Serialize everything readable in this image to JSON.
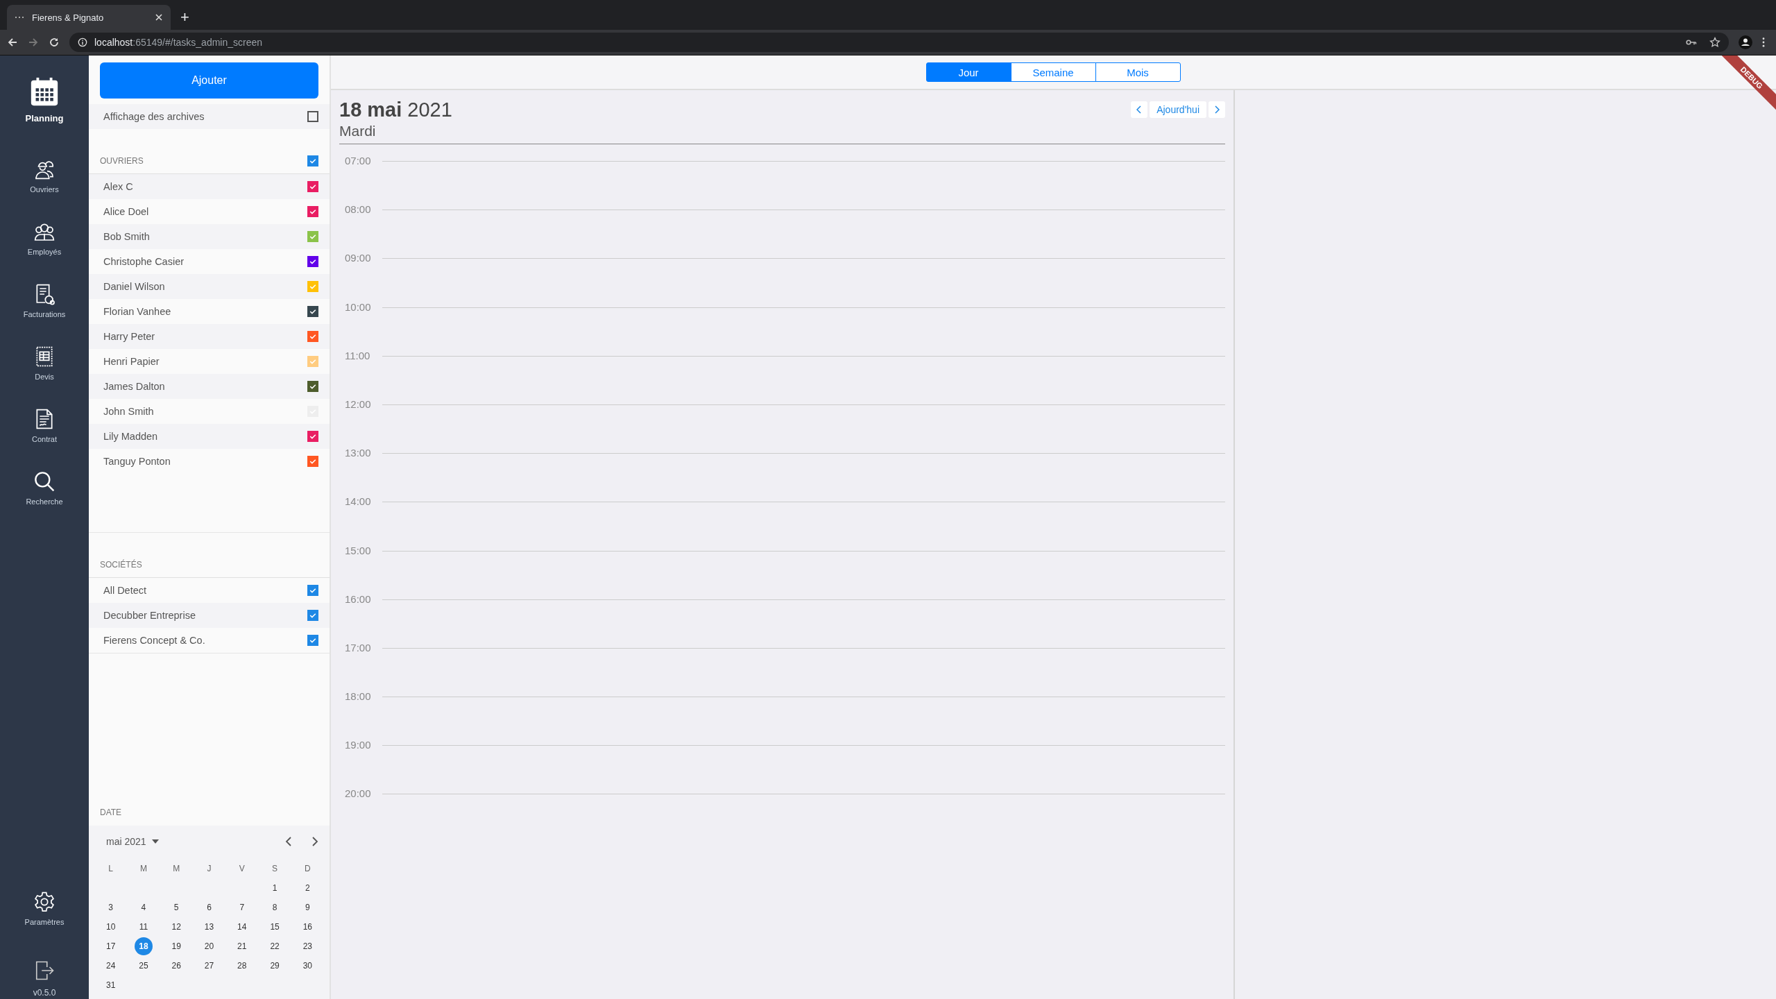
{
  "browser": {
    "tab_title": "Fierens & Pignato",
    "new_tab": "+",
    "url": {
      "host": "localhost",
      "path": ":65149/#/tasks_admin_screen"
    }
  },
  "nav": {
    "items": [
      {
        "label": "Planning",
        "selected": true
      },
      {
        "label": "Ouvriers",
        "selected": false
      },
      {
        "label": "Employés",
        "selected": false
      },
      {
        "label": "Facturations",
        "selected": false
      },
      {
        "label": "Devis",
        "selected": false
      },
      {
        "label": "Contrat",
        "selected": false
      },
      {
        "label": "Recherche",
        "selected": false
      }
    ],
    "settings": {
      "label": "Paramètres"
    },
    "version": "v0.5.0"
  },
  "panel": {
    "add_button": "Ajouter",
    "archives": {
      "label": "Affichage des archives",
      "checked": false
    },
    "workers": {
      "title": "OUVRIERS",
      "checked": true,
      "items": [
        {
          "name": "Alex C",
          "checked": true,
          "color": "#e91e63"
        },
        {
          "name": "Alice Doel",
          "checked": true,
          "color": "#e91e63"
        },
        {
          "name": "Bob Smith",
          "checked": true,
          "color": "#8bc34a"
        },
        {
          "name": "Christophe Casier",
          "checked": true,
          "color": "#6200ea"
        },
        {
          "name": "Daniel Wilson",
          "checked": true,
          "color": "#ffc107"
        },
        {
          "name": "Florian Vanhee",
          "checked": true,
          "color": "#37474f"
        },
        {
          "name": "Harry Peter",
          "checked": true,
          "color": "#ff5722"
        },
        {
          "name": "Henri Papier",
          "checked": true,
          "color": "#ffcc80"
        },
        {
          "name": "James Dalton",
          "checked": true,
          "color": "#4e5d2c"
        },
        {
          "name": "John Smith",
          "checked": true,
          "color": "#eeeeee"
        },
        {
          "name": "Lily Madden",
          "checked": true,
          "color": "#e91e63"
        },
        {
          "name": "Tanguy Ponton",
          "checked": true,
          "color": "#ff5722"
        }
      ]
    },
    "companies": {
      "title": "SOCIÉTÉS",
      "items": [
        {
          "name": "All Detect",
          "checked": true
        },
        {
          "name": "Decubber Entreprise",
          "checked": true
        },
        {
          "name": "Fierens Concept & Co.",
          "checked": true
        }
      ]
    },
    "date": {
      "title": "DATE",
      "month": "mai 2021",
      "weekdays": [
        "L",
        "M",
        "M",
        "J",
        "V",
        "S",
        "D"
      ],
      "weeks": [
        [
          {
            "day": "1",
            "selected": false
          },
          {
            "day": "2",
            "selected": false
          }
        ],
        [
          {
            "day": "3",
            "selected": false
          },
          {
            "day": "4",
            "selected": false
          },
          {
            "day": "5",
            "selected": false
          },
          {
            "day": "6",
            "selected": false
          },
          {
            "day": "7",
            "selected": false
          },
          {
            "day": "8",
            "selected": false
          },
          {
            "day": "9",
            "selected": false
          }
        ],
        [
          {
            "day": "10",
            "selected": false
          },
          {
            "day": "11",
            "selected": false
          },
          {
            "day": "12",
            "selected": false
          },
          {
            "day": "13",
            "selected": false
          },
          {
            "day": "14",
            "selected": false
          },
          {
            "day": "15",
            "selected": false
          },
          {
            "day": "16",
            "selected": false
          }
        ],
        [
          {
            "day": "17",
            "selected": false
          },
          {
            "day": "18",
            "selected": true
          },
          {
            "day": "19",
            "selected": false
          },
          {
            "day": "20",
            "selected": false
          },
          {
            "day": "21",
            "selected": false
          },
          {
            "day": "22",
            "selected": false
          },
          {
            "day": "23",
            "selected": false
          }
        ],
        [
          {
            "day": "24",
            "selected": false
          },
          {
            "day": "25",
            "selected": false
          },
          {
            "day": "26",
            "selected": false
          },
          {
            "day": "27",
            "selected": false
          },
          {
            "day": "28",
            "selected": false
          },
          {
            "day": "29",
            "selected": false
          },
          {
            "day": "30",
            "selected": false
          }
        ],
        [
          {
            "day": "31",
            "selected": false
          }
        ]
      ]
    }
  },
  "views": [
    {
      "label": "Jour",
      "selected": true
    },
    {
      "label": "Semaine",
      "selected": false
    },
    {
      "label": "Mois",
      "selected": false
    }
  ],
  "day": {
    "date": "18 mai",
    "year": "2021",
    "weekday": "Mardi",
    "today_button": "Ajourd'hui",
    "hours": [
      "07:00",
      "08:00",
      "09:00",
      "10:00",
      "11:00",
      "12:00",
      "13:00",
      "14:00",
      "15:00",
      "16:00",
      "17:00",
      "18:00",
      "19:00",
      "20:00"
    ]
  },
  "debug_banner": "DEBUG"
}
